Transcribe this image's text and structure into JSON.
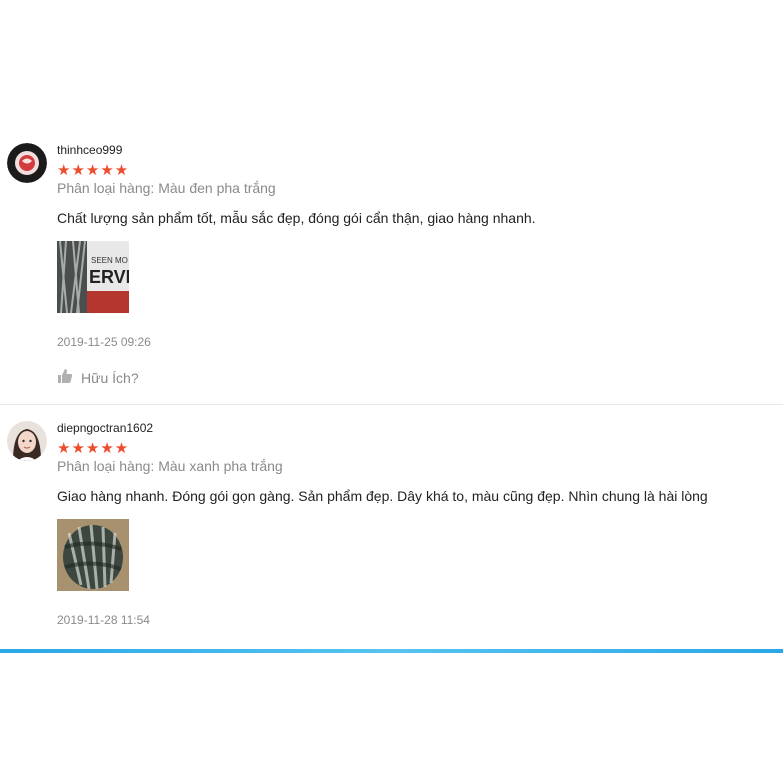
{
  "reviews": [
    {
      "username": "thinhceo999",
      "stars": "★★★★★",
      "rating": 5,
      "variant": "Phân loại hàng: Màu đen pha trắng",
      "comment": "Chất lượng sản phẩm tốt, mẫu sắc đẹp, đóng gói cẩn thận, giao hàng nhanh.",
      "photo_text": "SEEN MO\nERVI",
      "timestamp": "2019-11-25 09:26",
      "helpful": "Hữu Ích?"
    },
    {
      "username": "diepngoctran1602",
      "stars": "★★★★★",
      "rating": 5,
      "variant": "Phân loại hàng: Màu xanh pha trắng",
      "comment": "Giao hàng nhanh. Đóng gói gọn gàng. Sản phẩm đẹp. Dây khá to, màu cũng đẹp. Nhìn chung là hài lòng",
      "timestamp": "2019-11-28 11:54"
    }
  ],
  "colors": {
    "star": "#ee4d2d",
    "muted": "#8a8a8a",
    "accent_bar": "#2aa7e6"
  }
}
